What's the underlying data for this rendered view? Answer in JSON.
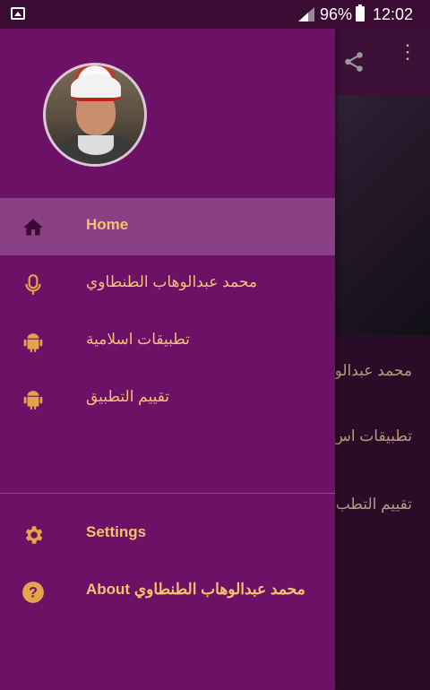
{
  "status": {
    "battery_pct": "96%",
    "time": "12:02"
  },
  "drawer": {
    "items": [
      {
        "label": "Home",
        "icon": "home-icon"
      },
      {
        "label": "محمد عبدالوهاب الطنطاوي",
        "icon": "mic-icon"
      },
      {
        "label": "تطبيقات اسلامية",
        "icon": "android-icon"
      },
      {
        "label": "تقييم التطبيق",
        "icon": "android-icon"
      }
    ],
    "bottom": [
      {
        "label": "Settings",
        "icon": "gear-icon"
      },
      {
        "label": "About محمد عبدالوهاب الطنطاوي",
        "icon": "help-icon"
      }
    ]
  },
  "behind": {
    "rows": [
      "محمد عبدالو",
      "تطبيقات اس",
      "تقييم التطب"
    ]
  },
  "colors": {
    "drawer_bg": "#6d1167",
    "accent": "#f1c36d"
  }
}
